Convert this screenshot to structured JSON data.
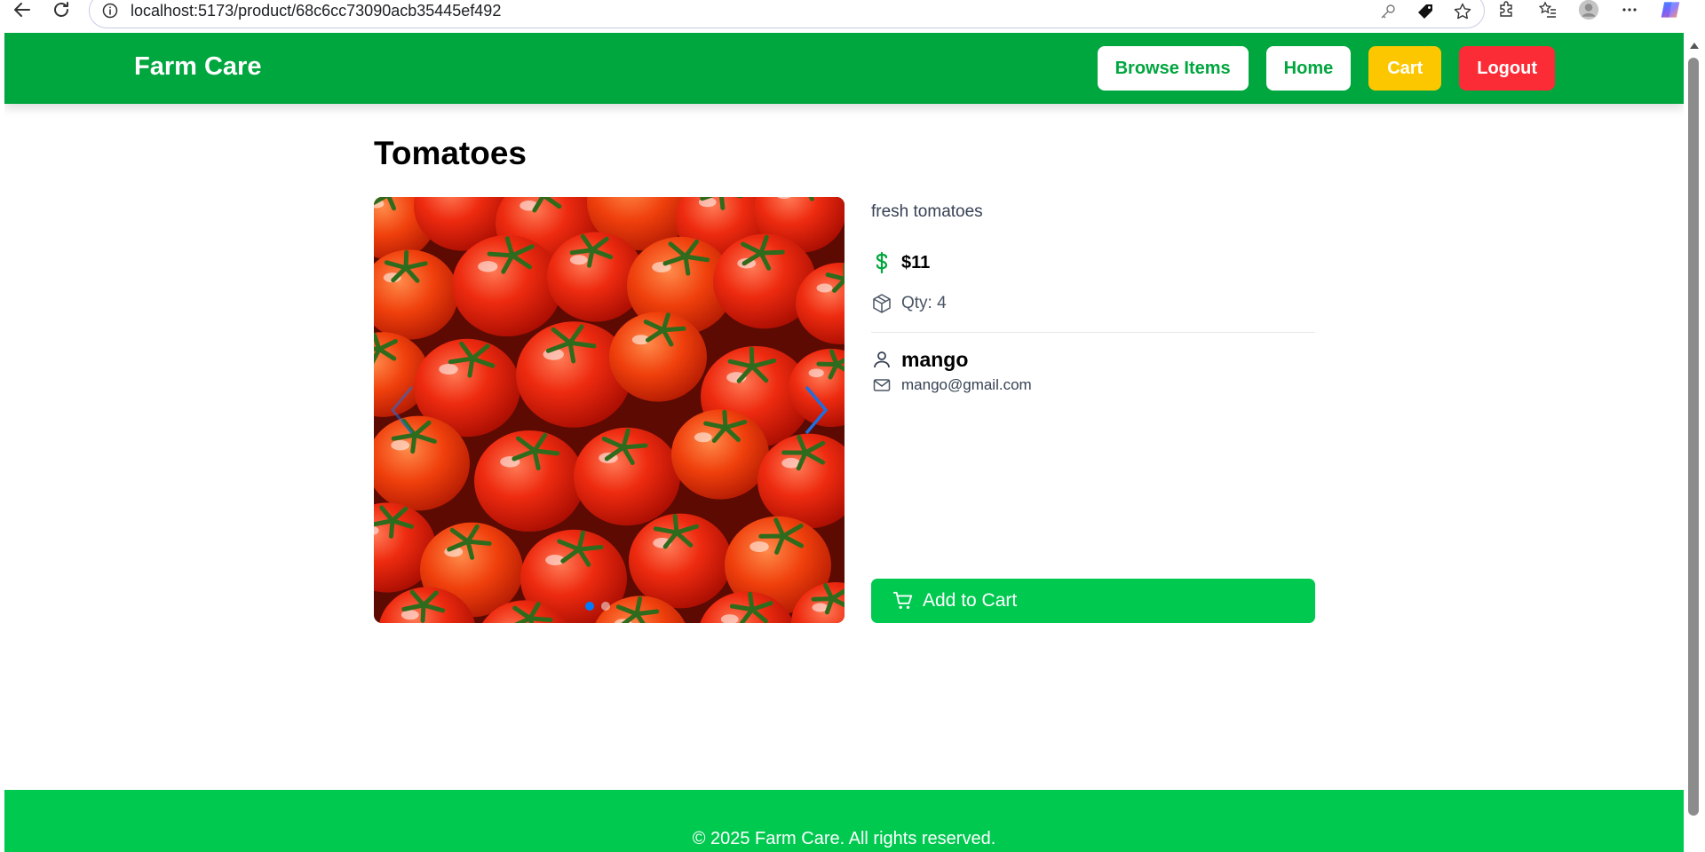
{
  "browser": {
    "url": "localhost:5173/product/68c6cc73090acb35445ef492",
    "icons": [
      "back-icon",
      "reload-icon",
      "site-info-icon",
      "key-icon",
      "tag-icon",
      "star-icon",
      "extensions-icon",
      "favorites-icon",
      "profile-icon",
      "more-icon",
      "copilot-icon"
    ]
  },
  "header": {
    "brand": "Farm Care",
    "nav": {
      "browse": "Browse Items",
      "home": "Home",
      "cart": "Cart",
      "logout": "Logout"
    }
  },
  "product": {
    "title": "Tomatoes",
    "description": "fresh tomatoes",
    "price": "$11",
    "qty": "Qty: 4",
    "seller": {
      "name": "mango",
      "email": "mango@gmail.com"
    },
    "add_to_cart": "Add to Cart",
    "carousel": {
      "slide_count": 2,
      "active_slide": 1
    }
  },
  "footer": {
    "text": "© 2025 Farm Care. All rights reserved."
  },
  "colors": {
    "header_green": "#00a63e",
    "button_green": "#00c950",
    "cart_yellow": "#fdc700",
    "logout_red": "#fb2c36",
    "dot_blue": "#007aff"
  }
}
